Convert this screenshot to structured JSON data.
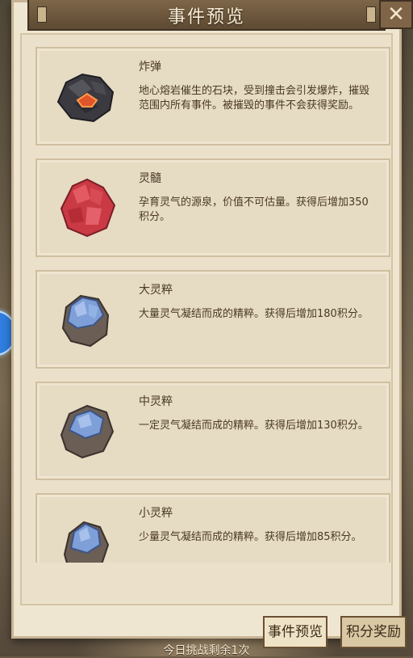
{
  "window": {
    "title": "事件预览",
    "close_label": "✕"
  },
  "events": [
    {
      "name": "炸弹",
      "desc": "地心熔岩催生的石块，受到撞击会引发爆炸，摧毁范围内所有事件。被摧毁的事件不会获得奖励。",
      "icon": "bomb-rock-icon"
    },
    {
      "name": "灵髓",
      "desc": "孕育灵气的源泉，价值不可估量。获得后增加350积分。",
      "icon": "red-crystal-icon"
    },
    {
      "name": "大灵粹",
      "desc": "大量灵气凝结而成的精粹。获得后增加180积分。",
      "icon": "large-blue-ore-icon"
    },
    {
      "name": "中灵粹",
      "desc": "一定灵气凝结而成的精粹。获得后增加130积分。",
      "icon": "medium-blue-ore-icon"
    },
    {
      "name": "小灵粹",
      "desc": "少量灵气凝结而成的精粹。获得后增加85积分。",
      "icon": "small-blue-ore-icon"
    }
  ],
  "footer": {
    "remaining_text": "今日挑战剩余1次",
    "tab_preview": "事件预览",
    "tab_reward": "积分奖励"
  }
}
